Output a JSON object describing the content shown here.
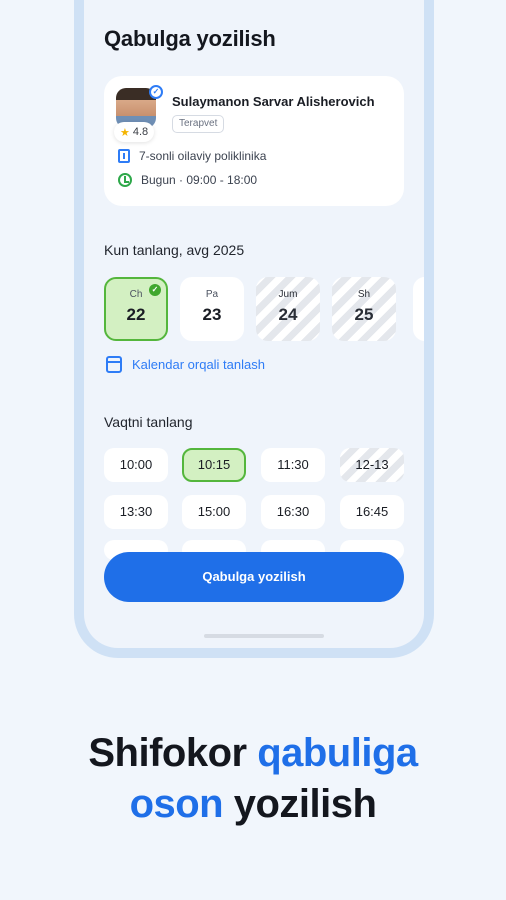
{
  "screen": {
    "title": "Qabulga yozilish"
  },
  "doctor": {
    "name": "Sulaymanon Sarvar Alisherovich",
    "specialty": "Terapvet",
    "rating": "4.8",
    "clinic": "7-sonli oilaviy poliklinika",
    "hours": "Bugun · 09:00 - 18:00"
  },
  "date_section": {
    "label": "Kun tanlang, avg  2025",
    "days": [
      {
        "name": "Ch",
        "number": "22",
        "state": "selected"
      },
      {
        "name": "Pa",
        "number": "23",
        "state": "available"
      },
      {
        "name": "Jum",
        "number": "24",
        "state": "disabled"
      },
      {
        "name": "Sh",
        "number": "25",
        "state": "disabled"
      }
    ],
    "calendar_link": "Kalendar orqali tanlash"
  },
  "time_section": {
    "label": "Vaqtni tanlang",
    "slots": [
      {
        "time": "10:00",
        "state": "available"
      },
      {
        "time": "10:15",
        "state": "selected"
      },
      {
        "time": "11:30",
        "state": "available"
      },
      {
        "time": "12-13",
        "state": "disabled"
      },
      {
        "time": "13:30",
        "state": "available"
      },
      {
        "time": "15:00",
        "state": "available"
      },
      {
        "time": "16:30",
        "state": "available"
      },
      {
        "time": "16:45",
        "state": "available"
      }
    ]
  },
  "cta": {
    "label": "Qabulga yozilish"
  },
  "headline": {
    "part1": "Shifokor ",
    "part2": "qabuliga",
    "part3": "oson",
    "part4": " yozilish"
  },
  "colors": {
    "accent": "#1f6fe8",
    "selected_bg": "#d3f0c2",
    "selected_border": "#54b63c",
    "background": "#f1f6fc"
  }
}
